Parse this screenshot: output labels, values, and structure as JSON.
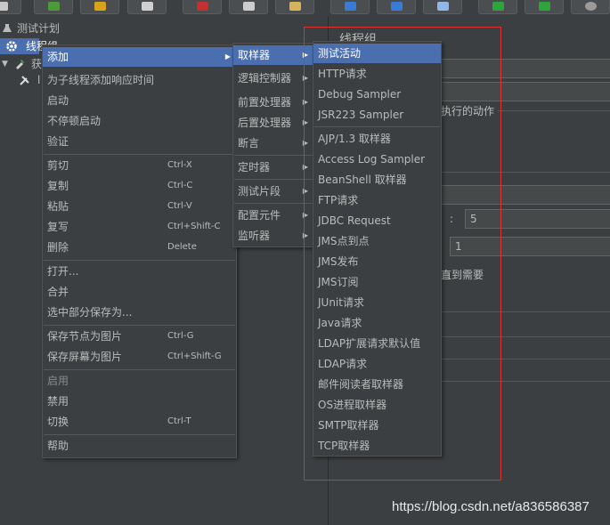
{
  "colors": {
    "background": "#3c3f41",
    "selection": "#4b6eaf",
    "highlight_box": "#e03030"
  },
  "toolbar": {
    "buttons": [
      {
        "icon": "new-file-icon"
      },
      {
        "icon": "templates-icon"
      },
      {
        "icon": "open-folder-icon"
      },
      {
        "icon": "save-icon"
      },
      {
        "icon": "cut-icon"
      },
      {
        "icon": "copy-icon"
      },
      {
        "icon": "paste-icon"
      },
      {
        "icon": "expand-icon"
      },
      {
        "icon": "collapse-icon"
      },
      {
        "icon": "toggle-icon"
      },
      {
        "icon": "start-icon"
      },
      {
        "icon": "start-no-pause-icon"
      },
      {
        "icon": "stop-icon"
      }
    ]
  },
  "tree": {
    "test_plan": "测试计划",
    "thread_group": "线程组",
    "child1": "获",
    "child2": "l"
  },
  "context_menu": {
    "items": [
      {
        "label": "添加",
        "shortcut": "",
        "submenu": true
      },
      {
        "label": "为子线程添加响应时间",
        "shortcut": ""
      },
      {
        "label": "启动",
        "shortcut": ""
      },
      {
        "label": "不停顿启动",
        "shortcut": ""
      },
      {
        "label": "验证",
        "shortcut": ""
      },
      {
        "label": "剪切",
        "shortcut": "Ctrl-X"
      },
      {
        "label": "复制",
        "shortcut": "Ctrl-C"
      },
      {
        "label": "粘贴",
        "shortcut": "Ctrl-V"
      },
      {
        "label": "复写",
        "shortcut": "Ctrl+Shift-C"
      },
      {
        "label": "删除",
        "shortcut": "Delete"
      },
      {
        "label": "打开...",
        "shortcut": ""
      },
      {
        "label": "合并",
        "shortcut": ""
      },
      {
        "label": "选中部分保存为...",
        "shortcut": ""
      },
      {
        "label": "保存节点为图片",
        "shortcut": "Ctrl-G"
      },
      {
        "label": "保存屏幕为图片",
        "shortcut": "Ctrl+Shift-G"
      },
      {
        "label": "启用",
        "shortcut": "",
        "disabled": true
      },
      {
        "label": "禁用",
        "shortcut": ""
      },
      {
        "label": "切换",
        "shortcut": "Ctrl-T"
      },
      {
        "label": "帮助",
        "shortcut": ""
      }
    ]
  },
  "add_menu": {
    "items": [
      {
        "label": "取样器"
      },
      {
        "label": "逻辑控制器"
      },
      {
        "label": "前置处理器"
      },
      {
        "label": "后置处理器"
      },
      {
        "label": "断言"
      },
      {
        "label": "定时器"
      },
      {
        "label": "测试片段"
      },
      {
        "label": "配置元件"
      },
      {
        "label": "监听器"
      }
    ]
  },
  "sampler_menu": {
    "items": [
      "测试活动",
      "HTTP请求",
      "Debug Sampler",
      "JSR223 Sampler",
      "AJP/1.3 取样器",
      "Access Log Sampler",
      "BeanShell 取样器",
      "FTP请求",
      "JDBC Request",
      "JMS点到点",
      "JMS发布",
      "JMS订阅",
      "JUnit请求",
      "Java请求",
      "LDAP扩展请求默认值",
      "LDAP请求",
      "邮件阅读者取样器",
      "OS进程取样器",
      "SMTP取样器",
      "TCP取样器"
    ]
  },
  "right_panel": {
    "title": "线程组",
    "action_label": "执行的动作",
    "colon": ":",
    "threads_value": "5",
    "ramp_value": "1",
    "delay_label": "直到需要"
  },
  "watermark": "https://blog.csdn.net/a836586387"
}
